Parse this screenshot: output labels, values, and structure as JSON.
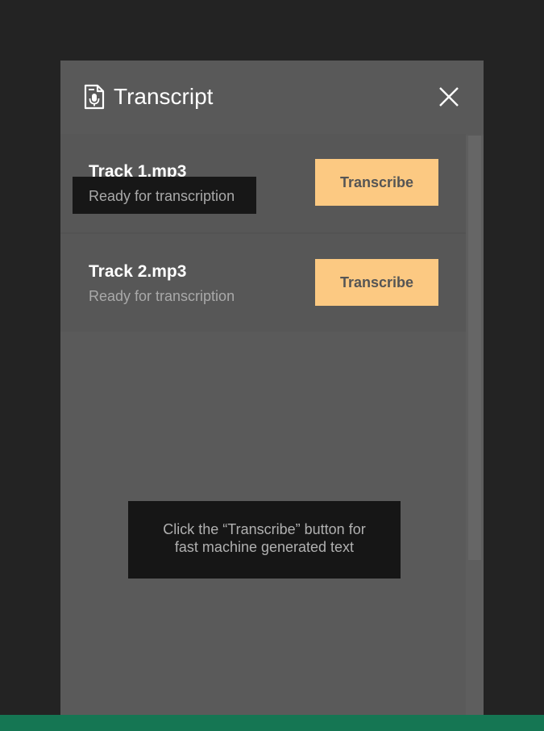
{
  "panel": {
    "title": "Transcript",
    "icon": "transcript-document-mic-icon",
    "close_icon": "close-icon"
  },
  "tracks": [
    {
      "name": "Track 1.mp3",
      "status": "Ready for transcription",
      "button_label": "Transcribe"
    },
    {
      "name": "Track 2.mp3",
      "status": "Ready for transcription",
      "button_label": "Transcribe"
    }
  ],
  "hint": {
    "line1": "Click the “Transcribe” button for",
    "line2": "fast machine generated text"
  },
  "colors": {
    "background": "#232323",
    "panel": "#5a5a5a",
    "button": "#fcc982",
    "button_text": "#555555",
    "status_bar": "#157653",
    "tooltip": "#161616"
  }
}
